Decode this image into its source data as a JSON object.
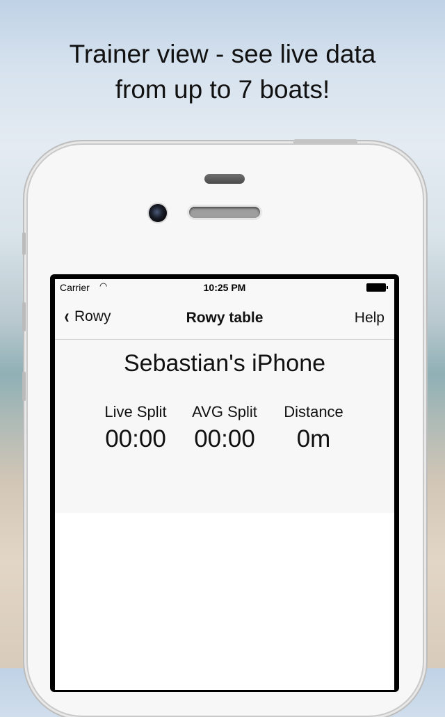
{
  "headline": {
    "line1": "Trainer view - see live data",
    "line2": "from up to 7 boats!"
  },
  "statusbar": {
    "carrier": "Carrier",
    "time": "10:25 PM"
  },
  "navbar": {
    "back_label": "Rowy",
    "title": "Rowy table",
    "help_label": "Help"
  },
  "device": {
    "name": "Sebastian's iPhone",
    "stats": [
      {
        "label": "Live Split",
        "value": "00:00"
      },
      {
        "label": "AVG Split",
        "value": "00:00"
      },
      {
        "label": "Distance",
        "value": "0m"
      }
    ]
  }
}
